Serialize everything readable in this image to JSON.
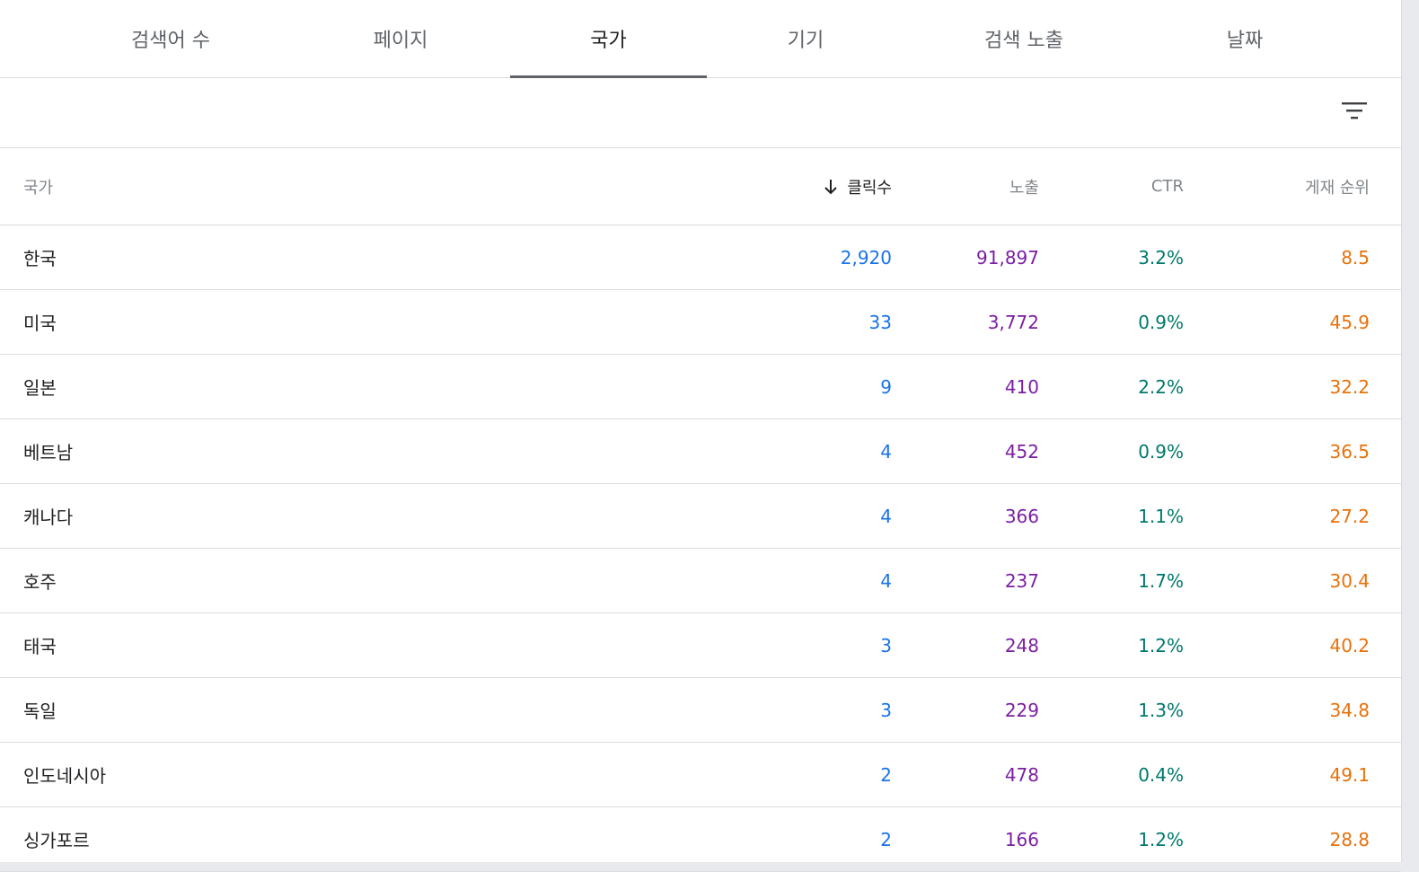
{
  "tabs": [
    "검색어 수",
    "페이지",
    "국가",
    "기기",
    "검색 노출",
    "날짜"
  ],
  "active_tab": "국가",
  "toolbar": {
    "filter_icon": "filter-list-icon"
  },
  "table": {
    "headers": {
      "country": "국가",
      "clicks": "클릭수",
      "impressions": "노출",
      "ctr": "CTR",
      "position": "게재 순위"
    },
    "sort_icon": "arrow-downward-icon",
    "rows": [
      {
        "country": "한국",
        "clicks": "2,920",
        "impressions": "91,897",
        "ctr": "3.2%",
        "position": "8.5"
      },
      {
        "country": "미국",
        "clicks": "33",
        "impressions": "3,772",
        "ctr": "0.9%",
        "position": "45.9"
      },
      {
        "country": "일본",
        "clicks": "9",
        "impressions": "410",
        "ctr": "2.2%",
        "position": "32.2"
      },
      {
        "country": "베트남",
        "clicks": "4",
        "impressions": "452",
        "ctr": "0.9%",
        "position": "36.5"
      },
      {
        "country": "캐나다",
        "clicks": "4",
        "impressions": "366",
        "ctr": "1.1%",
        "position": "27.2"
      },
      {
        "country": "호주",
        "clicks": "4",
        "impressions": "237",
        "ctr": "1.7%",
        "position": "30.4"
      },
      {
        "country": "태국",
        "clicks": "3",
        "impressions": "248",
        "ctr": "1.2%",
        "position": "40.2"
      },
      {
        "country": "독일",
        "clicks": "3",
        "impressions": "229",
        "ctr": "1.3%",
        "position": "34.8"
      },
      {
        "country": "인도네시아",
        "clicks": "2",
        "impressions": "478",
        "ctr": "0.4%",
        "position": "49.1"
      },
      {
        "country": "싱가포르",
        "clicks": "2",
        "impressions": "166",
        "ctr": "1.2%",
        "position": "28.8"
      }
    ]
  },
  "colors": {
    "clicks": "#1a73e8",
    "impressions": "#7b1fa2",
    "ctr": "#00796b",
    "position": "#e8710a"
  }
}
